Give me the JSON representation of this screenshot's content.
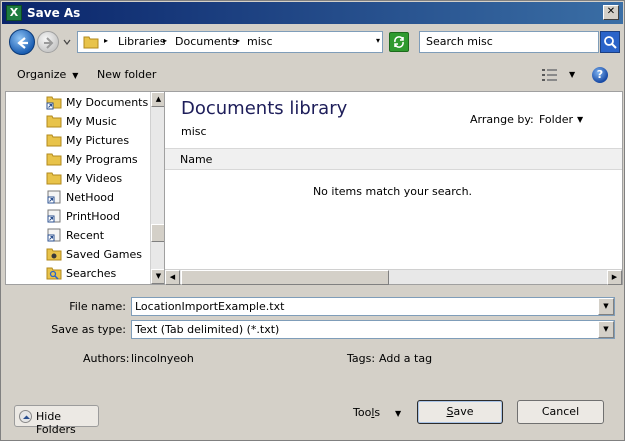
{
  "window": {
    "title": "Save As",
    "app_icon_letter": "X",
    "close_glyph": "✕"
  },
  "address": {
    "crumbs": [
      "Libraries",
      "Documents",
      "misc"
    ],
    "separator": "▸",
    "dropdown_glyph": "▾"
  },
  "search": {
    "text": "Search misc"
  },
  "toolbar": {
    "organize": "Organize",
    "new_folder": "New folder",
    "help": "?"
  },
  "nav": {
    "items": [
      {
        "label": "My Documents",
        "icon": "shortcut-folder-icon"
      },
      {
        "label": "My Music",
        "icon": "folder-icon"
      },
      {
        "label": "My Pictures",
        "icon": "folder-icon"
      },
      {
        "label": "My Programs",
        "icon": "folder-icon"
      },
      {
        "label": "My Videos",
        "icon": "folder-icon"
      },
      {
        "label": "NetHood",
        "icon": "shortcut-icon"
      },
      {
        "label": "PrintHood",
        "icon": "shortcut-icon"
      },
      {
        "label": "Recent",
        "icon": "shortcut-icon"
      },
      {
        "label": "Saved Games",
        "icon": "saved-games-icon"
      },
      {
        "label": "Searches",
        "icon": "searches-icon"
      }
    ]
  },
  "main": {
    "library_title": "Documents library",
    "library_sub": "misc",
    "arrange_label": "Arrange by:",
    "arrange_value": "Folder",
    "column_name": "Name",
    "empty_message": "No items match your search."
  },
  "fields": {
    "file_name_label": "File name:",
    "file_name_value": "LocationImportExample.txt",
    "save_type_label": "Save as type:",
    "save_type_value": "Text (Tab delimited) (*.txt)",
    "authors_label": "Authors:",
    "authors_value": "lincolnyeoh",
    "tags_label": "Tags:",
    "tags_value": "Add a tag"
  },
  "footer": {
    "hide_folders": "Hide Folders",
    "tools": "Tools",
    "save": "Save",
    "cancel": "Cancel"
  },
  "colors": {
    "title_bar_start": "#0a246a",
    "title_bar_end": "#3a6ea5",
    "dialog_bg": "#d4d0c8",
    "library_title": "#1e1e5a"
  }
}
